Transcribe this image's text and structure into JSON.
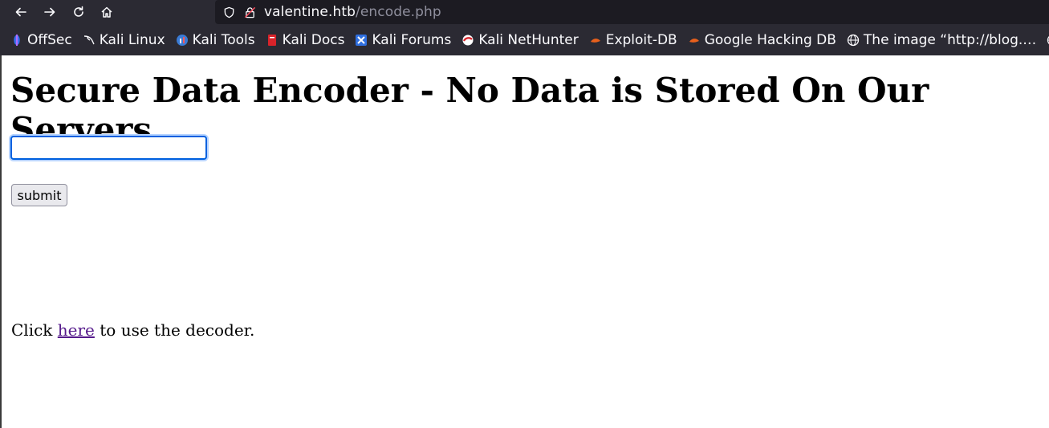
{
  "browser": {
    "url_host": "valentine.htb",
    "url_path": "/encode.php",
    "bookmarks": [
      {
        "label": "OffSec",
        "icon": "offsec-icon"
      },
      {
        "label": "Kali Linux",
        "icon": "kali-dragon-icon"
      },
      {
        "label": "Kali Tools",
        "icon": "kali-tools-icon"
      },
      {
        "label": "Kali Docs",
        "icon": "kali-docs-icon"
      },
      {
        "label": "Kali Forums",
        "icon": "kali-forums-icon"
      },
      {
        "label": "Kali NetHunter",
        "icon": "nethunter-icon"
      },
      {
        "label": "Exploit-DB",
        "icon": "exploit-db-icon"
      },
      {
        "label": "Google Hacking DB",
        "icon": "ghdb-icon"
      },
      {
        "label": "The image “http://blog.…",
        "icon": "globe-icon"
      }
    ]
  },
  "page": {
    "title": "Secure Data Encoder - No Data is Stored On Our Servers",
    "input_value": "",
    "submit_label": "submit",
    "click_prefix": "Click ",
    "link_text": "here",
    "click_suffix": " to use the decoder."
  },
  "colors": {
    "chrome_bg": "#2b2a33",
    "urlbar_bg": "#1c1b22",
    "link": "#551a8b",
    "focus_ring": "#0060df"
  }
}
